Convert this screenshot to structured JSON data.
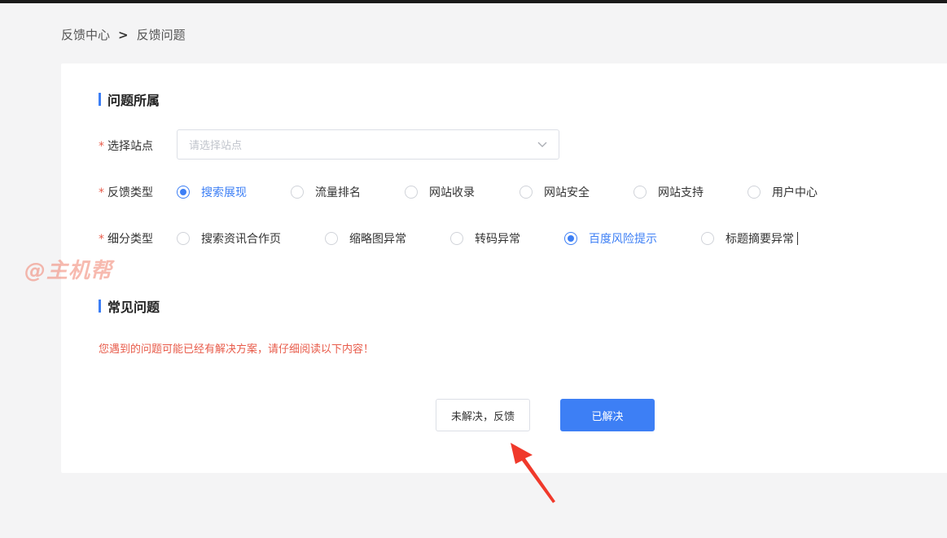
{
  "breadcrumb": {
    "root": "反馈中心",
    "separator": ">",
    "current": "反馈问题"
  },
  "section1": {
    "title": "问题所属"
  },
  "site": {
    "label": "选择站点",
    "required_mark": "*",
    "placeholder": "请选择站点"
  },
  "feedback_type": {
    "label": "反馈类型",
    "required_mark": "*",
    "options": [
      "搜索展现",
      "流量排名",
      "网站收录",
      "网站安全",
      "网站支持",
      "用户中心"
    ],
    "selected": "搜索展现"
  },
  "sub_type": {
    "label": "细分类型",
    "required_mark": "*",
    "options": [
      "搜索资讯合作页",
      "缩略图异常",
      "转码异常",
      "百度风险提示",
      "标题摘要异常"
    ],
    "selected": "百度风险提示"
  },
  "section2": {
    "title": "常见问题"
  },
  "notice": "您遇到的问题可能已经有解决方案，请仔细阅读以下内容！",
  "buttons": {
    "unresolved": "未解决，反馈",
    "resolved": "已解决"
  },
  "watermark": "@主机帮",
  "colors": {
    "accent": "#3d7ff5",
    "required": "#e85b4a",
    "arrow": "#f0392b"
  }
}
